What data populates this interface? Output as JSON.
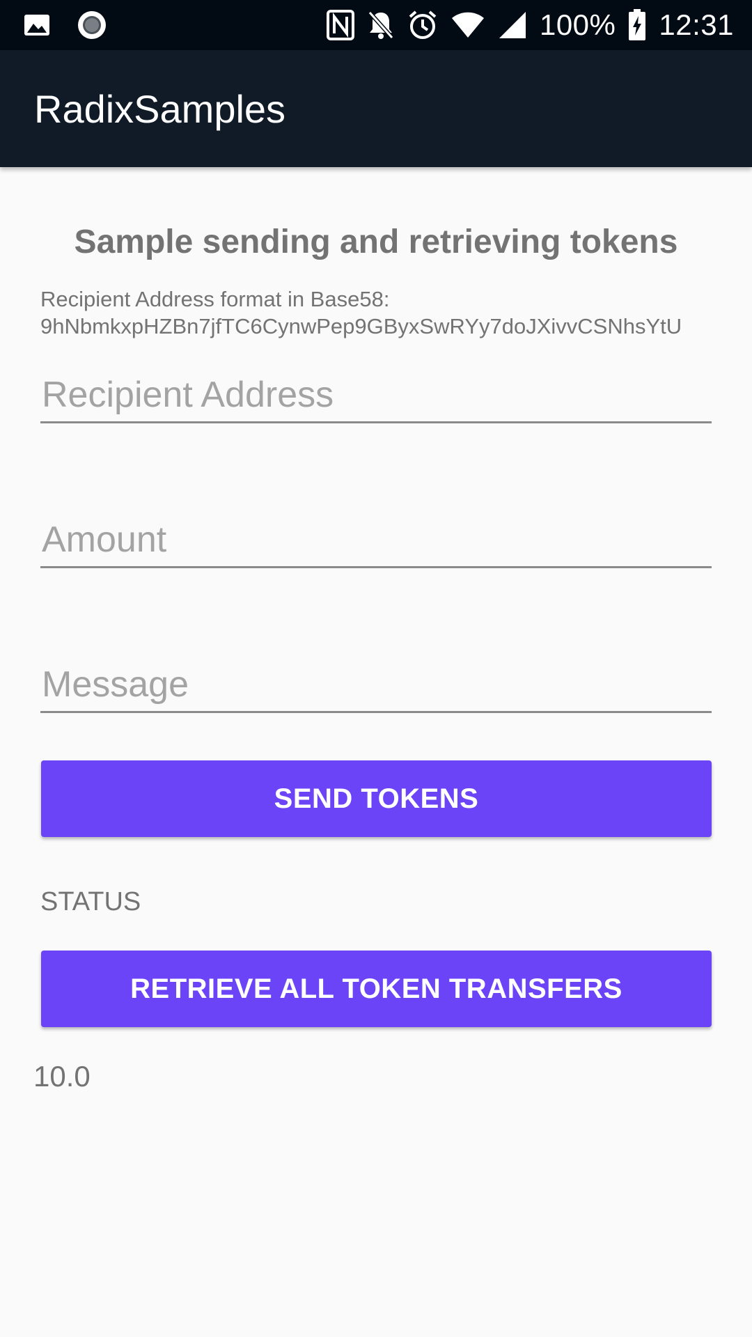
{
  "status_bar": {
    "icons_left": [
      "image-icon",
      "record-icon"
    ],
    "icons_right": [
      "nfc-icon",
      "notifications-off-icon",
      "alarm-icon",
      "wifi-icon",
      "signal-icon"
    ],
    "battery_percent": "100%",
    "battery_icon": "battery-charging-icon",
    "time": "12:31"
  },
  "app_bar": {
    "title": "RadixSamples"
  },
  "main": {
    "heading": "Sample sending and retrieving tokens",
    "hint_line1": "Recipient Address format in Base58:",
    "hint_line2": "9hNbmkxpHZBn7jfTC6CynwPep9GByxSwRYy7doJXivvCSNhsYtU",
    "recipient_placeholder": "Recipient Address",
    "amount_placeholder": "Amount",
    "message_placeholder": "Message",
    "send_button": "SEND TOKENS",
    "status_label": "STATUS",
    "retrieve_button": "RETRIEVE ALL TOKEN TRANSFERS",
    "result_value": "10.0"
  },
  "colors": {
    "status_bar_bg": "#020b14",
    "app_bar_bg": "#101b27",
    "accent_button": "#6c44f8",
    "text_gray": "#737373",
    "background": "#fafafa"
  }
}
